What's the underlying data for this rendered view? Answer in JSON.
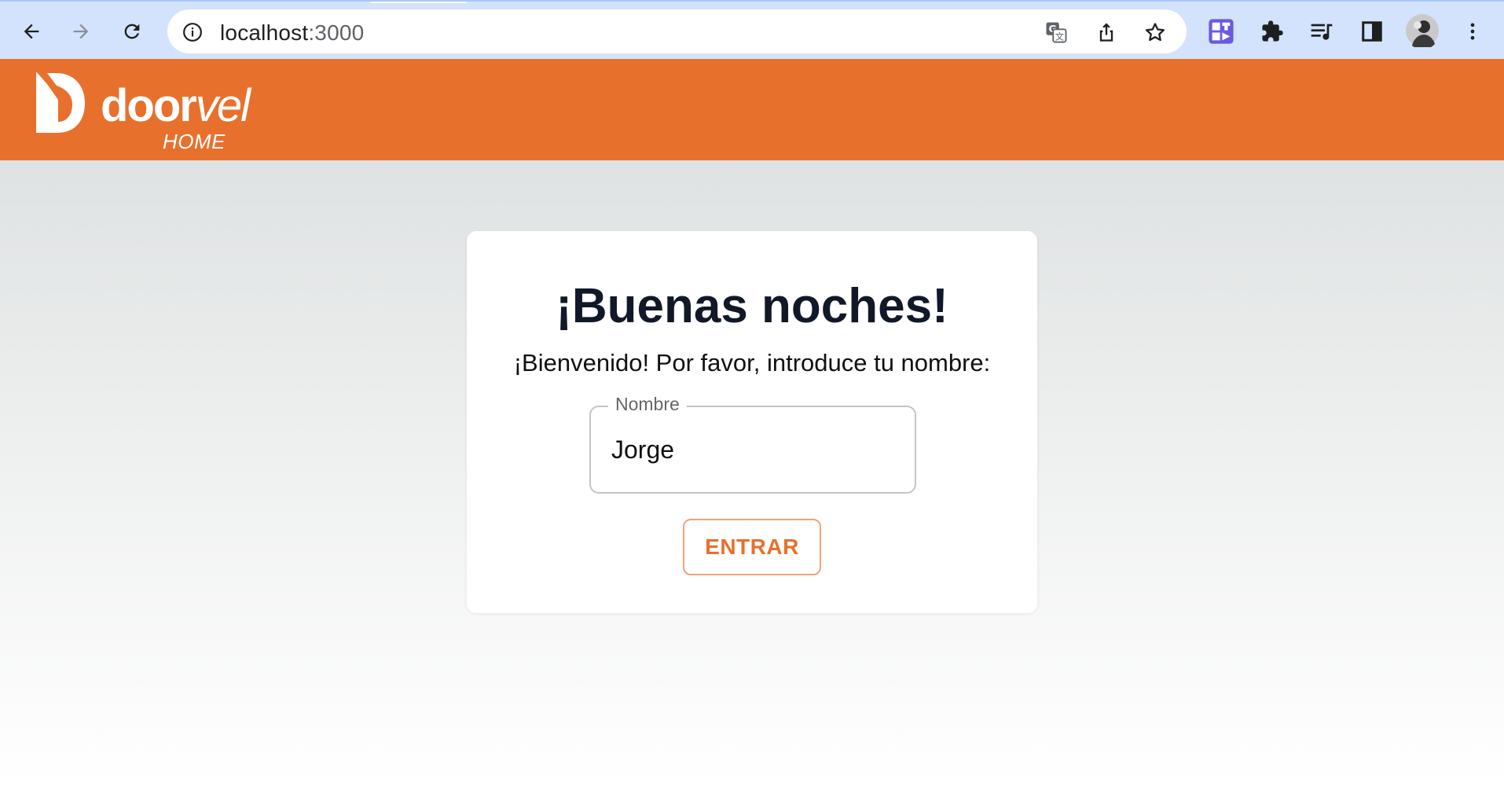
{
  "browser": {
    "url_host": "localhost",
    "url_port": ":3000",
    "icons": {
      "back": "back-arrow-icon",
      "forward": "forward-arrow-icon",
      "reload": "reload-icon",
      "site_info": "info-icon",
      "translate": "translate-icon",
      "share": "share-icon",
      "bookmark": "star-icon",
      "extension_1": "extension-app-icon",
      "extensions": "puzzle-icon",
      "media": "media-queue-icon",
      "side_panel": "side-panel-icon",
      "profile": "avatar",
      "menu": "kebab-menu-icon"
    }
  },
  "app": {
    "logo_word_bold": "door",
    "logo_word_light": "vel",
    "logo_sub": "HOME",
    "colors": {
      "brand": "#e8702d",
      "button_border": "#f2a37a",
      "title": "#111827"
    }
  },
  "card": {
    "title": "¡Buenas noches!",
    "text": "¡Bienvenido! Por favor, introduce tu nombre:",
    "field_label": "Nombre",
    "field_value": "Jorge",
    "button_label": "ENTRAR"
  }
}
